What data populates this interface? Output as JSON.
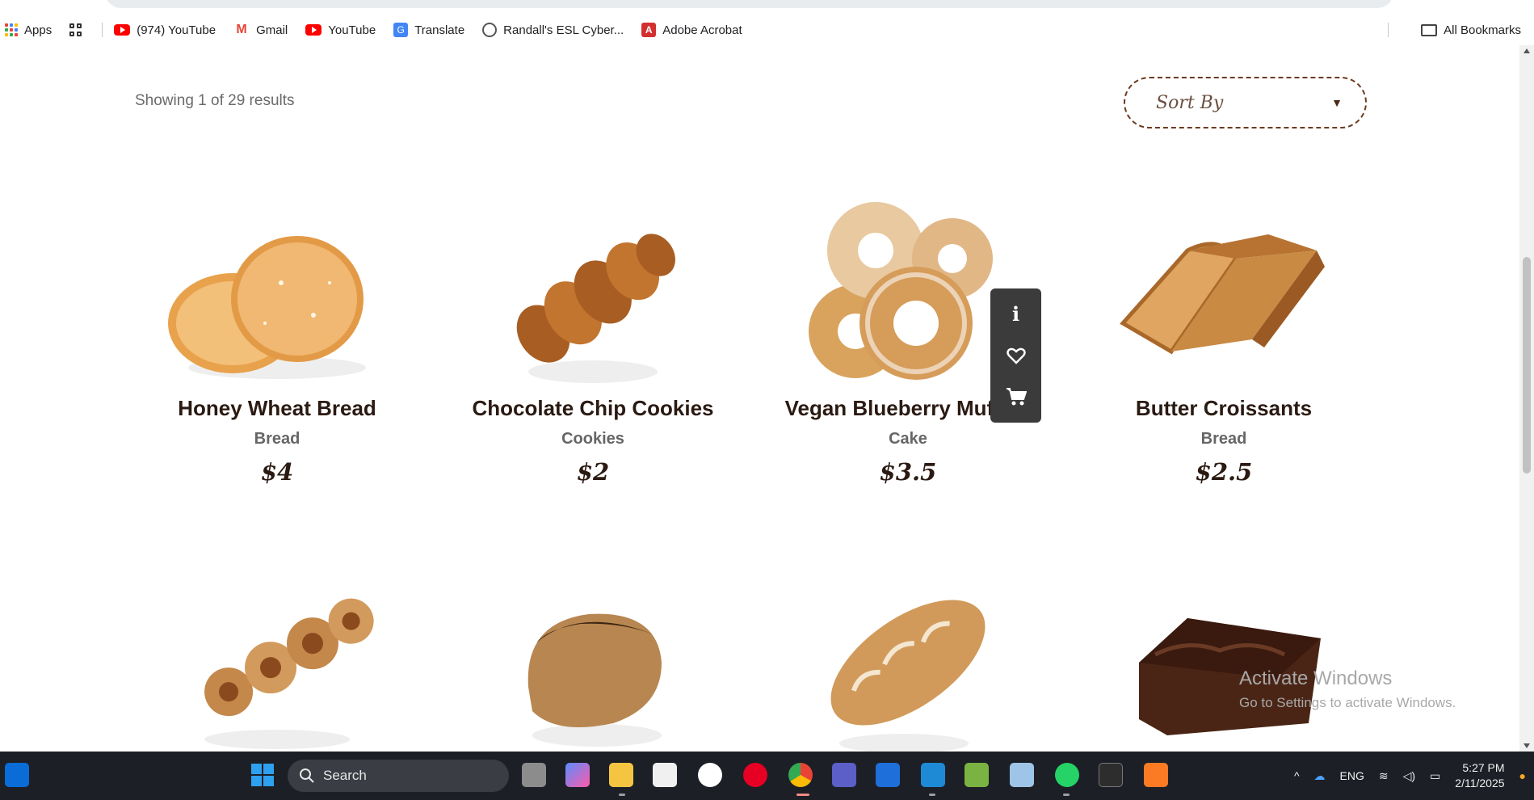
{
  "bookmarks": {
    "items": [
      {
        "label": "Apps",
        "icon": "apps-grid-icon"
      },
      {
        "label": "(974) YouTube",
        "icon": "youtube-icon"
      },
      {
        "label": "Gmail",
        "icon": "gmail-icon"
      },
      {
        "label": "YouTube",
        "icon": "youtube-icon"
      },
      {
        "label": "Translate",
        "icon": "translate-icon"
      },
      {
        "label": "Randall's ESL Cyber...",
        "icon": "headphones-icon"
      },
      {
        "label": "Adobe Acrobat",
        "icon": "acrobat-icon"
      }
    ],
    "all_bookmarks": "All Bookmarks"
  },
  "shop": {
    "results_text": "Showing 1 of 29 results",
    "sort_label": "Sort By",
    "sort_caret": "▼"
  },
  "products": [
    {
      "name": "Honey Wheat Bread",
      "category": "Bread",
      "price": "$4",
      "image": "donuts"
    },
    {
      "name": "Chocolate Chip Cookies",
      "category": "Cookies",
      "price": "$2",
      "image": "braided-bread"
    },
    {
      "name": "Vegan Blueberry Muffins",
      "category": "Cake",
      "price": "$3.5",
      "image": "sugar-rings"
    },
    {
      "name": "Butter Croissants",
      "category": "Bread",
      "price": "$2.5",
      "image": "sliced-bread"
    },
    {
      "image": "cinnamon-rolls"
    },
    {
      "image": "whole-grain-loaf"
    },
    {
      "image": "rustic-bread"
    },
    {
      "image": "brownie"
    }
  ],
  "product_actions": {
    "info": "i"
  },
  "watermark": {
    "line1": "Activate Windows",
    "line2": "Go to Settings to activate Windows."
  },
  "taskbar": {
    "search_placeholder": "Search",
    "language": "ENG",
    "time": "5:27 PM",
    "date": "2/11/2025"
  },
  "colors": {
    "accent_brown": "#6b3a1f",
    "text_dark": "#2b1a12",
    "taskbar_bg": "#1c1f26"
  }
}
